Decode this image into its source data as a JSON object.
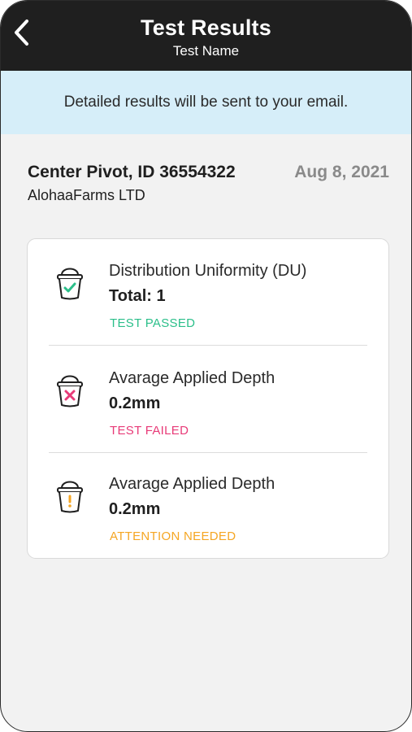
{
  "header": {
    "title": "Test Results",
    "subtitle": "Test Name",
    "back_icon": "chevron-left-icon"
  },
  "banner": {
    "text": "Detailed results will be sent to your email."
  },
  "device": {
    "name": "Center Pivot, ID 36554322",
    "date": "Aug 8, 2021",
    "farm": "AlohaaFarms LTD"
  },
  "results": [
    {
      "icon": "bucket-check-icon",
      "label": "Distribution Uniformity (DU)",
      "value": "Total: 1",
      "status": "TEST PASSED",
      "status_color": "#2bbf8a"
    },
    {
      "icon": "bucket-x-icon",
      "label": "Avarage Applied Depth",
      "value": "0.2mm",
      "status": "TEST FAILED",
      "status_color": "#e83b78"
    },
    {
      "icon": "bucket-alert-icon",
      "label": "Avarage Applied Depth",
      "value": "0.2mm",
      "status": "ATTENTION NEEDED",
      "status_color": "#f5a623"
    }
  ],
  "colors": {
    "header_bg": "#1f1f1f",
    "banner_bg": "#d6eef9",
    "page_bg": "#f2f2f2"
  }
}
